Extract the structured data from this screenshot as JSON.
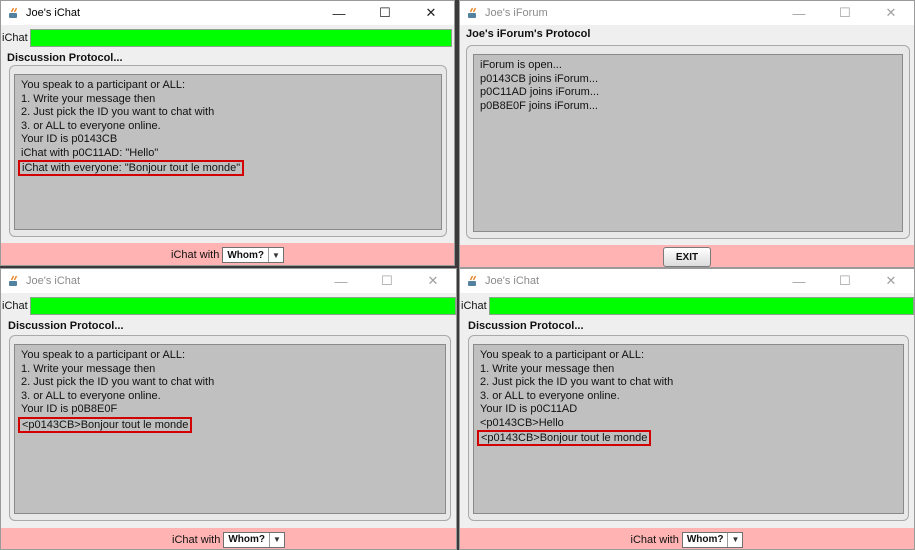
{
  "windows": {
    "chat1": {
      "title": "Joe's iChat",
      "input_label": "iChat",
      "section_title": "Discussion Protocol...",
      "lines": [
        "You speak to a participant or ALL:",
        "1. Write your message then",
        "2. Just pick the ID you want to chat with",
        "3. or ALL to everyone online.",
        "Your ID is p0143CB",
        "iChat with p0C11AD: \"Hello\"",
        "iChat with everyone: \"Bonjour tout le monde\""
      ],
      "highlighted_line_index": 6,
      "footer_label": "iChat with",
      "select_value": "Whom?"
    },
    "forum": {
      "title": "Joe's iForum",
      "section_title": "Joe's iForum's Protocol",
      "lines": [
        "iForum is open...",
        "p0143CB joins iForum...",
        "p0C11AD joins iForum...",
        "p0B8E0F joins iForum..."
      ],
      "exit_label": "EXIT"
    },
    "chat2": {
      "title": "Joe's iChat",
      "input_label": "iChat",
      "section_title": "Discussion Protocol...",
      "lines": [
        "You speak to a participant or ALL:",
        "1. Write your message then",
        "2. Just pick the ID you want to chat with",
        "3. or ALL to everyone online.",
        "Your ID is p0B8E0F",
        "<p0143CB>Bonjour tout le monde"
      ],
      "highlighted_line_index": 5,
      "footer_label": "iChat with",
      "select_value": "Whom?"
    },
    "chat3": {
      "title": "Joe's iChat",
      "input_label": "iChat",
      "section_title": "Discussion Protocol...",
      "lines": [
        "You speak to a participant or ALL:",
        "1. Write your message then",
        "2. Just pick the ID you want to chat with",
        "3. or ALL to everyone online.",
        "Your ID is p0C11AD",
        "<p0143CB>Hello",
        "<p0143CB>Bonjour tout le monde"
      ],
      "highlighted_line_index": 6,
      "footer_label": "iChat with",
      "select_value": "Whom?"
    }
  },
  "controls": {
    "minimize": "—",
    "maximize": "☐",
    "close": "✕"
  },
  "colors": {
    "input_green": "#00ff00",
    "footer_pink": "#ffb3b3",
    "highlight_red": "#d40000",
    "textarea_gray": "#c0c0c0"
  }
}
